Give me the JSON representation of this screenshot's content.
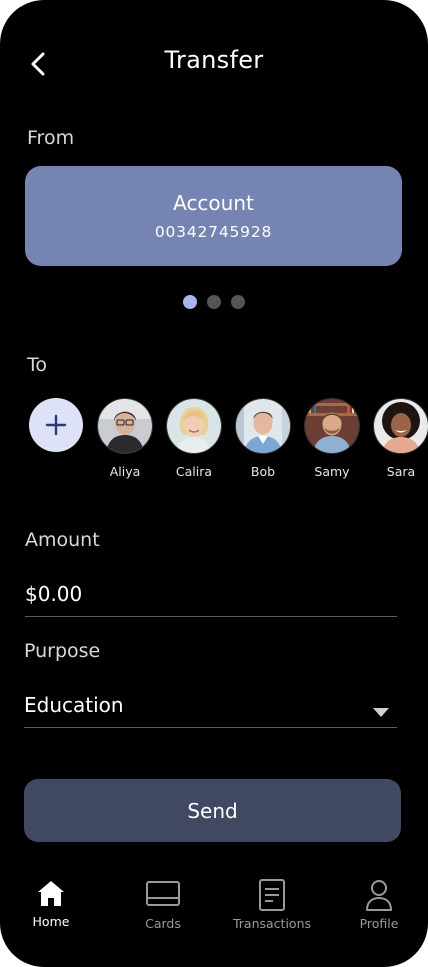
{
  "header": {
    "title": "Transfer"
  },
  "from": {
    "label": "From",
    "account": {
      "title": "Account",
      "number": "00342745928"
    },
    "pager": {
      "count": 3,
      "active_index": 0
    }
  },
  "to": {
    "label": "To",
    "contacts": [
      {
        "name": "Aliya"
      },
      {
        "name": "Calira"
      },
      {
        "name": "Bob"
      },
      {
        "name": "Samy"
      },
      {
        "name": "Sara"
      }
    ]
  },
  "amount": {
    "label": "Amount",
    "value": "$0.00"
  },
  "purpose": {
    "label": "Purpose",
    "selected": "Education"
  },
  "send": {
    "label": "Send"
  },
  "nav": {
    "items": [
      {
        "label": "Home",
        "icon": "home-icon",
        "active": true
      },
      {
        "label": "Cards",
        "icon": "card-icon",
        "active": false
      },
      {
        "label": "Transactions",
        "icon": "document-icon",
        "active": false
      },
      {
        "label": "Profile",
        "icon": "user-icon",
        "active": false
      }
    ]
  },
  "colors": {
    "background": "#000000",
    "card": "#7684b4",
    "button": "#414862",
    "dot_active": "#aab4e8",
    "add_contact": "#dde2f7"
  }
}
